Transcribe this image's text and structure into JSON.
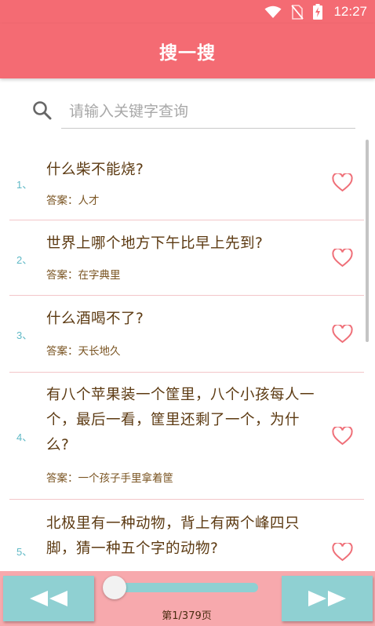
{
  "status_bar": {
    "time": "12:27",
    "icons": [
      "wifi-icon",
      "no-sim-icon",
      "battery-charging-icon"
    ]
  },
  "header": {
    "title": "搜一搜"
  },
  "search": {
    "placeholder": "请输入关键字查询",
    "value": "",
    "icon": "search-icon"
  },
  "items": [
    {
      "index": "1、",
      "question": "什么柴不能烧?",
      "answer": "答案：人才",
      "icon": "heart-outline-icon"
    },
    {
      "index": "2、",
      "question": "世界上哪个地方下午比早上先到?",
      "answer": "答案：在字典里",
      "icon": "heart-outline-icon"
    },
    {
      "index": "3、",
      "question": "什么酒喝不了?",
      "answer": "答案：天长地久",
      "icon": "heart-outline-icon"
    },
    {
      "index": "4、",
      "question": "有八个苹果装一个筐里，八个小孩每人一个，最后一看，筐里还剩了一个，为什么?",
      "answer": "答案：一个孩子手里拿着筐",
      "icon": "heart-outline-icon"
    },
    {
      "index": "5、",
      "question": "北极里有一种动物，背上有两个峰四只脚，猜一种五个字的动物?",
      "answer": "",
      "icon": "heart-outline-icon"
    }
  ],
  "pager": {
    "label": "第1/379页",
    "position": 0,
    "prev_icon": "rewind-icon",
    "next_icon": "fast-forward-icon"
  },
  "colors": {
    "primary": "#f46b73",
    "accent": "#8fd0d2",
    "bottom_bar": "#f7a9ad",
    "question_text": "#5c3a12",
    "index_text": "#5fb9c6"
  }
}
